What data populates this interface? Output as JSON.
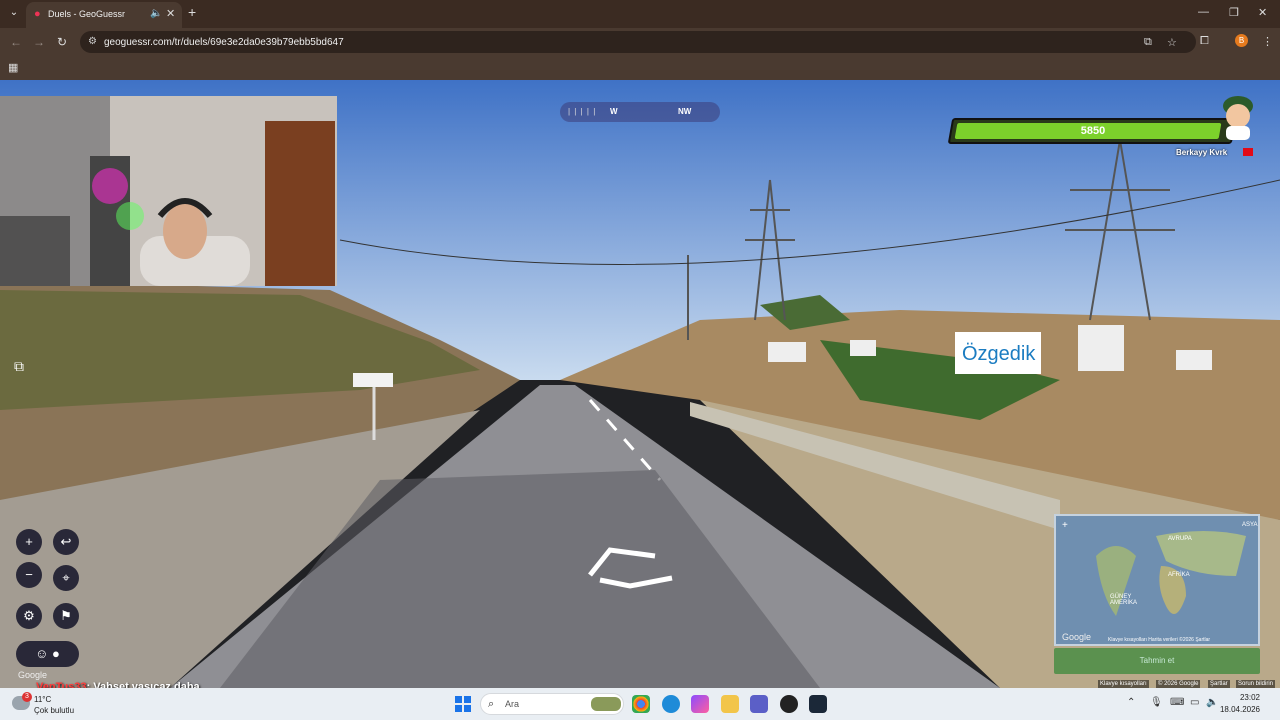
{
  "browser": {
    "tab_title": "Duels - GeoGuessr",
    "url": "geoguessr.com/tr/duels/69e3e2da0e39b79ebb5bd647",
    "profile_initial": "B"
  },
  "game": {
    "compass_ticks": "| | | | |",
    "compass_w": "W",
    "compass_nw": "NW",
    "health_value": "5850",
    "health_fraction": 0.97,
    "player_name": "Berkayy Kvrk",
    "map_labels": {
      "europe": "AVRUPA",
      "asia": "ASYA",
      "africa": "AFRİKA",
      "south_america": "GÜNEY AMERİKA"
    },
    "map_footer": "Klavye kısayolları   Harita verileri ©2026   Şartlar",
    "guess_button": "Tahmin et",
    "google_map_logo": "Google",
    "google_street_logo": "Google",
    "footer_links": [
      "Klavye kısayolları",
      "© 2026 Google",
      "Şartlar",
      "Sorun bildirin"
    ]
  },
  "chat": {
    "user": "VenTus33",
    "message": ": Vahşet yaşıcaz daha"
  },
  "taskbar": {
    "temperature": "11°C",
    "weather": "Çok bulutlu",
    "weather_badge": "3",
    "search_placeholder": "Ara",
    "time": "23:02",
    "date": "18.04.2026"
  }
}
